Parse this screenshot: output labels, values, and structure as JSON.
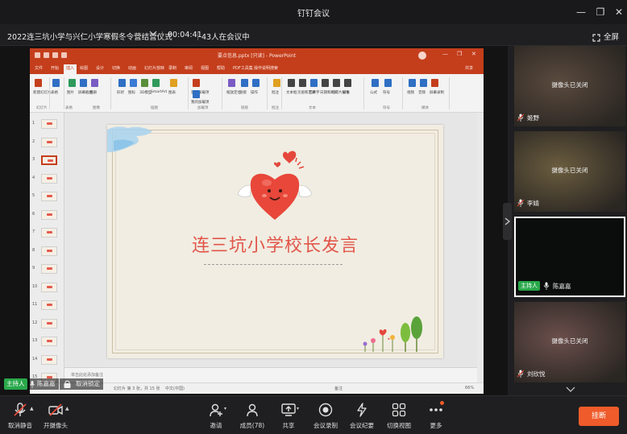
{
  "window": {
    "title": "钉钉会议",
    "controls": [
      "—",
      "❐",
      "✕"
    ]
  },
  "meeting": {
    "title": "2022连三坑小学与兴仁小学寒假冬令营结营仪式",
    "timer": "00:04:41",
    "participants_text": "43人在会议中",
    "fullscreen_label": "全屏"
  },
  "ppt": {
    "title": "要点信息.pptx [只读] - PowerPoint",
    "search": "操作说明搜索",
    "tabs": [
      "文件",
      "开始",
      "插入",
      "绘图",
      "设计",
      "切换",
      "动画",
      "幻灯片放映",
      "录制",
      "审阅",
      "视图",
      "帮助",
      "PDF工具集",
      "操作说明搜索"
    ],
    "share_label": "共享",
    "ribbon_items": [
      "新建幻灯片",
      "表格",
      "图片",
      "屏幕截图",
      "相册",
      "形状",
      "图标",
      "3D模型",
      "SmartArt",
      "图表",
      "获取加载项",
      "我的加载项",
      "缩放定位",
      "链接",
      "操作",
      "批注",
      "文本框",
      "页眉和页脚",
      "艺术字",
      "日期和时间",
      "幻灯片编号",
      "对象",
      "公式",
      "符号",
      "视频",
      "音频",
      "屏幕录制"
    ],
    "ribbon_groups": [
      "幻灯片",
      "表格",
      "图像",
      "插图",
      "加载项",
      "链接",
      "批注",
      "文本",
      "符号",
      "媒体"
    ],
    "slide_title": "连三坑小学校长发言",
    "notes_placeholder": "单击此处添加备注",
    "status_left": "幻灯片 第 3 张，共 15 张",
    "status_lang": "中文(中国)",
    "status_notes": "备注",
    "status_zoom": "66%",
    "thumbnail_numbers": [
      "1",
      "2",
      "3",
      "4",
      "5",
      "6",
      "7",
      "8",
      "9",
      "10",
      "11",
      "12",
      "13",
      "14",
      "15"
    ]
  },
  "share_overlay": {
    "host_tag": "主持人",
    "host_name": "陈嘉嘉",
    "lock_label": "取消锁定"
  },
  "participants": [
    {
      "name": "姬野",
      "status": "摄像头已关闭",
      "bg": "#5a4a3e"
    },
    {
      "name": "李婧",
      "status": "摄像头已关闭",
      "bg": "#6b5d3f"
    },
    {
      "name": "陈嘉嘉",
      "status": "",
      "host_tag": "主持人",
      "bg": "#0b0c0c"
    },
    {
      "name": "刘欣悦",
      "status": "摄像头已关闭",
      "bg": "#6b4f4c"
    }
  ],
  "toolbar": {
    "mute": "取消静音",
    "camera": "开摄像头",
    "invite": "邀请",
    "members": "成员(78)",
    "share": "共享",
    "record": "会议录制",
    "minutes": "会议纪要",
    "switch_view": "切换视图",
    "more": "更多",
    "hangup": "挂断"
  },
  "colors": {
    "ppt_accent": "#c43e1c",
    "host_green": "#29a84a",
    "hangup_orange": "#ef5b2a",
    "slide_title_red": "#e2564a"
  }
}
